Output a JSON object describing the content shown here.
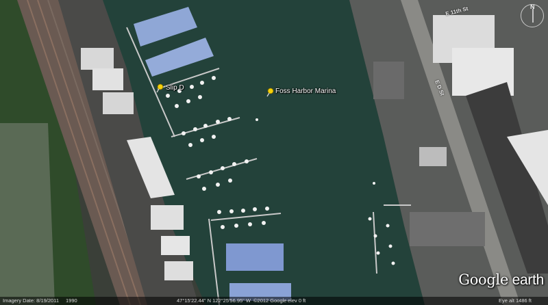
{
  "places": [
    {
      "name": "Slip D"
    },
    {
      "name": "Foss Harbor Marina"
    }
  ],
  "streets": [
    {
      "name": "E 11th St"
    },
    {
      "name": "E D St"
    }
  ],
  "logo": {
    "brand": "Google",
    "product": "earth"
  },
  "status": {
    "imagery_date": "Imagery Date: 8/19/2011",
    "year": "1990",
    "copyright": "©2012 Google",
    "coordinates": "47°15'22.44\" N  122°25'56.95\" W",
    "elevation": "elev   0 ft",
    "eye_alt": "Eye alt   1486 ft"
  },
  "icons": {
    "pin": "yellow-pushpin-icon",
    "compass": "compass-icon"
  }
}
